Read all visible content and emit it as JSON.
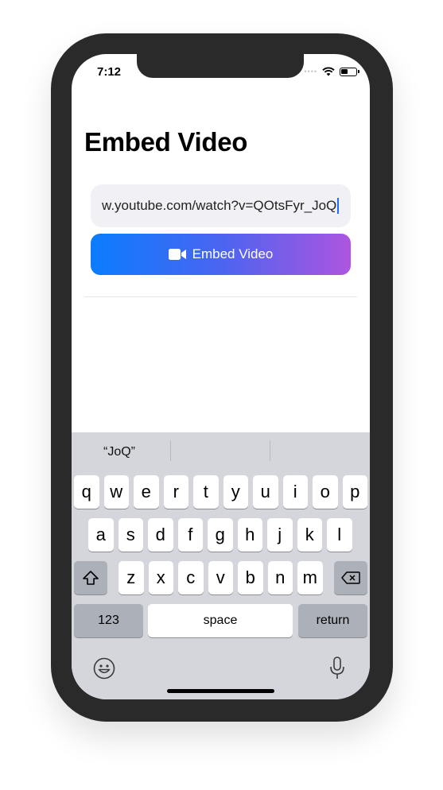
{
  "status_bar": {
    "time": "7:12",
    "signal": "••••"
  },
  "page": {
    "title": "Embed Video"
  },
  "url_field": {
    "value": "w.youtube.com/watch?v=QOtsFyr_JoQ"
  },
  "embed_button": {
    "label": "Embed Video",
    "icon": "video-camera-icon"
  },
  "keyboard": {
    "suggestions": [
      "“JoQ”",
      "",
      ""
    ],
    "row1": [
      "q",
      "w",
      "e",
      "r",
      "t",
      "y",
      "u",
      "i",
      "o",
      "p"
    ],
    "row2": [
      "a",
      "s",
      "d",
      "f",
      "g",
      "h",
      "j",
      "k",
      "l"
    ],
    "row3": [
      "z",
      "x",
      "c",
      "v",
      "b",
      "n",
      "m"
    ],
    "numbers_label": "123",
    "space_label": "space",
    "return_label": "return"
  },
  "colors": {
    "gradient_start": "#0a7cff",
    "gradient_end": "#ad55e0",
    "keyboard_bg": "#d4d6dc"
  }
}
